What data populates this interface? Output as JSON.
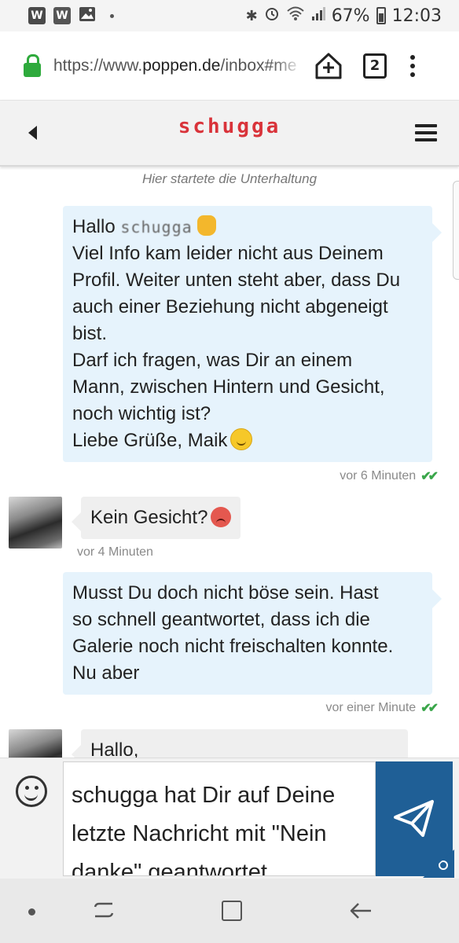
{
  "status_bar": {
    "app_icons": [
      "W",
      "W",
      "image-icon"
    ],
    "battery": "67%",
    "time": "12:03"
  },
  "browser": {
    "url_scheme": "https://www.",
    "url_host": "poppen.de",
    "url_path": "/inbox#me",
    "tab_count": "2"
  },
  "header": {
    "title": "schugga"
  },
  "conversation": {
    "started_notice": "Hier startete die Unterhaltung",
    "messages": [
      {
        "direction": "outgoing",
        "greeting": "Hallo",
        "greeting_name": "schugga",
        "lines": [
          "Viel Info kam leider nicht aus Deinem",
          "Profil. Weiter unten steht aber, dass Du",
          "auch einer Beziehung nicht abgeneigt",
          "bist.",
          "Darf ich fragen, was Dir an einem",
          "Mann, zwischen Hintern und Gesicht,",
          "noch wichtig ist?",
          "Liebe Grüße, Maik"
        ],
        "time": "vor 6 Minuten",
        "read": true
      },
      {
        "direction": "incoming",
        "lines": [
          "Kein Gesicht?"
        ],
        "time": "vor 4 Minuten"
      },
      {
        "direction": "outgoing",
        "lines": [
          "Musst Du doch nicht böse sein. Hast",
          "so schnell geantwortet, dass ich die",
          "Galerie noch nicht freischalten konnte.",
          "Nu aber"
        ],
        "time": "vor einer Minute",
        "read": true
      },
      {
        "direction": "incoming",
        "lines": [
          "Hallo,"
        ]
      }
    ]
  },
  "composer": {
    "text_lines": [
      "schugga hat Dir auf Deine",
      "letzte Nachricht mit \"Nein",
      "danke\" geantwortet."
    ]
  },
  "colors": {
    "outgoing_bubble": "#e6f3fc",
    "incoming_bubble": "#efefef",
    "send_button": "#1f5f96",
    "read_checks": "#3aa64a",
    "brand_red": "#d9333a",
    "lock_green": "#2eaa3c"
  }
}
